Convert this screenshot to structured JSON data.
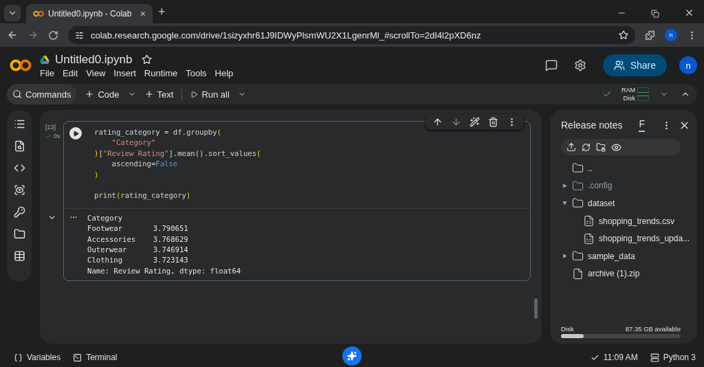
{
  "browser": {
    "tab": {
      "title": "Untitled0.ipynb - Colab",
      "close": "×"
    },
    "new_tab": "+",
    "url": "colab.research.google.com/drive/1sizyxhr61J9IDWyPlsmWU2X1LgenrMl_#scrollTo=2dI4l2pXD6nz",
    "profile": "n"
  },
  "notebook": {
    "title": "Untitled0.ipynb",
    "menu": [
      "File",
      "Edit",
      "View",
      "Insert",
      "Runtime",
      "Tools",
      "Help"
    ],
    "share": "Share",
    "avatar": "n"
  },
  "toolbar": {
    "commands": "Commands",
    "code": "Code",
    "text": "Text",
    "run_all": "Run all",
    "ram": "RAM",
    "disk": "Disk"
  },
  "cell": {
    "count": "[13]",
    "time": "0s",
    "code": [
      {
        "indented": false,
        "tokens": [
          {
            "kind": "plain",
            "text": "rating_category = df.groupby"
          },
          {
            "kind": "bracket",
            "text": "("
          }
        ]
      },
      {
        "indented": true,
        "tokens": [
          {
            "kind": "string",
            "text": "\"Category\""
          }
        ]
      },
      {
        "indented": false,
        "tokens": [
          {
            "kind": "bracket",
            "text": ")"
          },
          {
            "kind": "plain",
            "text": "["
          },
          {
            "kind": "string",
            "text": "\"Review Rating\""
          },
          {
            "kind": "plain",
            "text": "].mean().sort_values"
          },
          {
            "kind": "bracket",
            "text": "("
          }
        ]
      },
      {
        "indented": true,
        "tokens": [
          {
            "kind": "plain",
            "text": "ascending="
          },
          {
            "kind": "keyword",
            "text": "False"
          }
        ]
      },
      {
        "indented": false,
        "tokens": [
          {
            "kind": "bracket",
            "text": ")"
          }
        ]
      },
      {
        "indented": false,
        "spaced": true,
        "tokens": [
          {
            "kind": "func",
            "text": "print"
          },
          {
            "kind": "bracket",
            "text": "("
          },
          {
            "kind": "plain",
            "text": "rating_category"
          },
          {
            "kind": "bracket",
            "text": ")"
          }
        ]
      }
    ],
    "output": [
      "Category",
      "Footwear       3.790651",
      "Accessories    3.768629",
      "Outerwear      3.746914",
      "Clothing       3.723143",
      "Name: Review Rating, dtype: float64"
    ]
  },
  "files": {
    "title": "Release notes",
    "tab": "F",
    "items": [
      {
        "kind": "folder",
        "name": ".."
      },
      {
        "kind": "folder",
        "name": ".config",
        "dimmed": true,
        "expanded": false
      },
      {
        "kind": "folder",
        "name": "dataset",
        "expanded": true,
        "children": [
          {
            "kind": "csv",
            "name": "shopping_trends.csv"
          },
          {
            "kind": "csv",
            "name": "shopping_trends_upda..."
          }
        ]
      },
      {
        "kind": "folder",
        "name": "sample_data",
        "expanded": false
      },
      {
        "kind": "file",
        "name": "archive (1).zip"
      }
    ],
    "disk": {
      "label": "Disk",
      "available": "87.35 GB available",
      "level": 0.19
    }
  },
  "status_bar": {
    "variables": "Variables",
    "terminal": "Terminal",
    "time": "11:09 AM",
    "runtime": "Python 3"
  }
}
